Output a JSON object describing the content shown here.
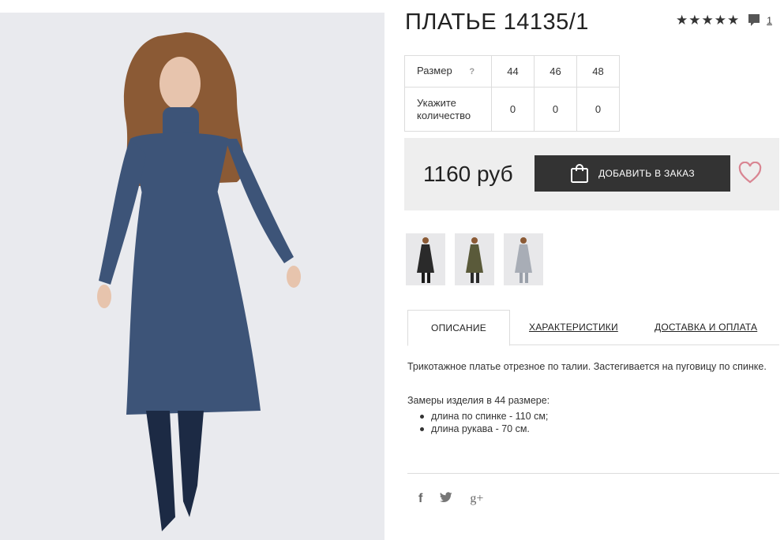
{
  "product": {
    "title": "ПЛАТЬЕ 14135/1",
    "rating_stars": "★★★★★",
    "comment_count": "1"
  },
  "sizes": {
    "size_label": "Размер",
    "help": "?",
    "values": [
      "44",
      "46",
      "48"
    ],
    "qty_label_line1": "Укажите",
    "qty_label_line2": "количество",
    "quantities": [
      "0",
      "0",
      "0"
    ]
  },
  "buy": {
    "price": "1160 руб",
    "button_label": "ДОБАВИТЬ В ЗАКАЗ"
  },
  "thumbnails": [
    {
      "name": "black-dress",
      "color": "#2a2a2a"
    },
    {
      "name": "olive-dress",
      "color": "#5a5a3a"
    },
    {
      "name": "grey-dress",
      "color": "#a8adb6"
    }
  ],
  "tabs": {
    "description": "ОПИСАНИЕ",
    "characteristics": "ХАРАКТЕРИСТИКИ",
    "delivery": "ДОСТАВКА И ОПЛАТА"
  },
  "description": {
    "text": "Трикотажное платье отрезное по талии. Застегивается на пуговицу по спинке.",
    "measures_title": "Замеры изделия в 44 размере:",
    "items": [
      "длина по спинке - 110 см;",
      "длина рукава - 70 см."
    ]
  },
  "social": {
    "facebook": "f",
    "twitter": "🐦",
    "google_plus": "g+"
  },
  "colors": {
    "dress": "#3d5478",
    "button": "#333333",
    "heart": "#d98592",
    "photo_bg": "#e9eaee"
  }
}
